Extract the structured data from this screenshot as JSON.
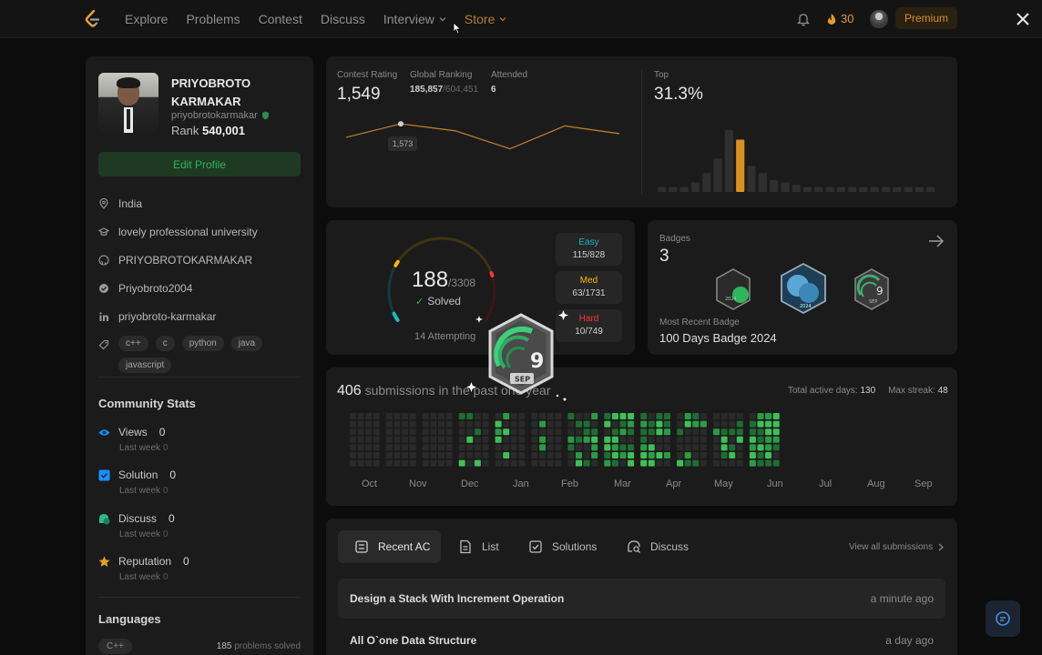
{
  "nav": {
    "links": [
      "Explore",
      "Problems",
      "Contest",
      "Discuss",
      "Interview",
      "Store"
    ],
    "streak": "30",
    "premium": "Premium"
  },
  "profile": {
    "name": "PRIYOBROTO KARMAKAR",
    "username": "priyobrotokarmakar",
    "rank_label": "Rank",
    "rank_value": "540,001",
    "edit_label": "Edit Profile",
    "info": [
      {
        "icon": "location-icon",
        "text": "India"
      },
      {
        "icon": "school-icon",
        "text": "lovely professional university"
      },
      {
        "icon": "github-icon",
        "text": "PRIYOBROTOKARMAKAR"
      },
      {
        "icon": "check-circle-icon",
        "text": "Priyobroto2004"
      },
      {
        "icon": "linkedin-icon",
        "text": "priyobroto-karmakar"
      }
    ],
    "skills": [
      "c++",
      "c",
      "python",
      "java",
      "javascript"
    ]
  },
  "community": {
    "title": "Community Stats",
    "last_week": "Last week",
    "stats": [
      {
        "label": "Views",
        "value": "0",
        "last_week": "0",
        "icon": "eye-icon",
        "color": "#1a90ff"
      },
      {
        "label": "Solution",
        "value": "0",
        "last_week": "0",
        "icon": "solution-icon",
        "color": "#1a90ff"
      },
      {
        "label": "Discuss",
        "value": "0",
        "last_week": "0",
        "icon": "discuss-icon",
        "color": "#2cbb8c"
      },
      {
        "label": "Reputation",
        "value": "0",
        "last_week": "0",
        "icon": "star-icon",
        "color": "#e3a127"
      }
    ]
  },
  "languages": {
    "title": "Languages",
    "items": [
      {
        "name": "C++",
        "count": "185",
        "suffix": "problems solved"
      }
    ]
  },
  "contest": {
    "rating_label": "Contest Rating",
    "rating": "1,549",
    "global_label": "Global Ranking",
    "global_rank": "185,857",
    "global_total": "/604,451",
    "attended_label": "Attended",
    "attended": "6",
    "top_label": "Top",
    "top_value": "31.3%",
    "tooltip": "1,573"
  },
  "chart_data": [
    {
      "type": "line",
      "title": "",
      "x": [
        1,
        2,
        3,
        4,
        5,
        6
      ],
      "values": [
        1540,
        1573,
        1556,
        1512,
        1568,
        1549
      ],
      "annotations": [
        "1,573"
      ],
      "ylim": [
        1480,
        1600
      ],
      "color": "#b67e2c"
    },
    {
      "type": "bar",
      "title": "",
      "values": [
        2,
        2,
        2,
        4,
        8,
        14,
        26,
        22,
        11,
        8,
        5,
        4,
        3,
        2,
        2,
        2,
        2,
        2,
        2,
        2,
        2,
        2,
        2,
        2,
        2
      ],
      "highlight_index": 7,
      "highlight_color": "#d9911e",
      "color": "#2f2f2f"
    }
  ],
  "solved": {
    "count": "188",
    "total": "/3308",
    "solved_label": "Solved",
    "attempting": "14 Attempting",
    "easy_label": "Easy",
    "easy": "115/828",
    "med_label": "Med",
    "med": "63/1731",
    "hard_label": "Hard",
    "hard": "10/749",
    "easy_solved": 115,
    "med_solved": 63,
    "hard_solved": 10,
    "total_count": 3308,
    "colors": {
      "easy": "#1cbaba",
      "med": "#ffb700",
      "hard": "#f63737"
    }
  },
  "badges": {
    "label": "Badges",
    "count": "3",
    "recent_label": "Most Recent Badge",
    "recent": "100 Days Badge 2024",
    "badge_texts": [
      "2024",
      "2024",
      "SEP"
    ],
    "float_text": "SEP",
    "float_number": "9"
  },
  "submissions": {
    "count": "406",
    "text": "submissions in the past one year",
    "active_label": "Total active days:",
    "active": "130",
    "streak_label": "Max streak:",
    "streak": "48",
    "months": [
      "Oct",
      "Nov",
      "Dec",
      "Jan",
      "Feb",
      "Mar",
      "Apr",
      "May",
      "Jun",
      "Jul",
      "Aug",
      "Sep"
    ]
  },
  "recent": {
    "tabs": [
      {
        "label": "Recent AC",
        "icon": "recent-ac-icon"
      },
      {
        "label": "List",
        "icon": "list-icon"
      },
      {
        "label": "Solutions",
        "icon": "solutions-icon"
      },
      {
        "label": "Discuss",
        "icon": "discuss-search-icon"
      }
    ],
    "view_all": "View all submissions",
    "rows": [
      {
        "title": "Design a Stack With Increment Operation",
        "time": "a minute ago"
      },
      {
        "title": "All O`one Data Structure",
        "time": "a day ago"
      }
    ]
  }
}
